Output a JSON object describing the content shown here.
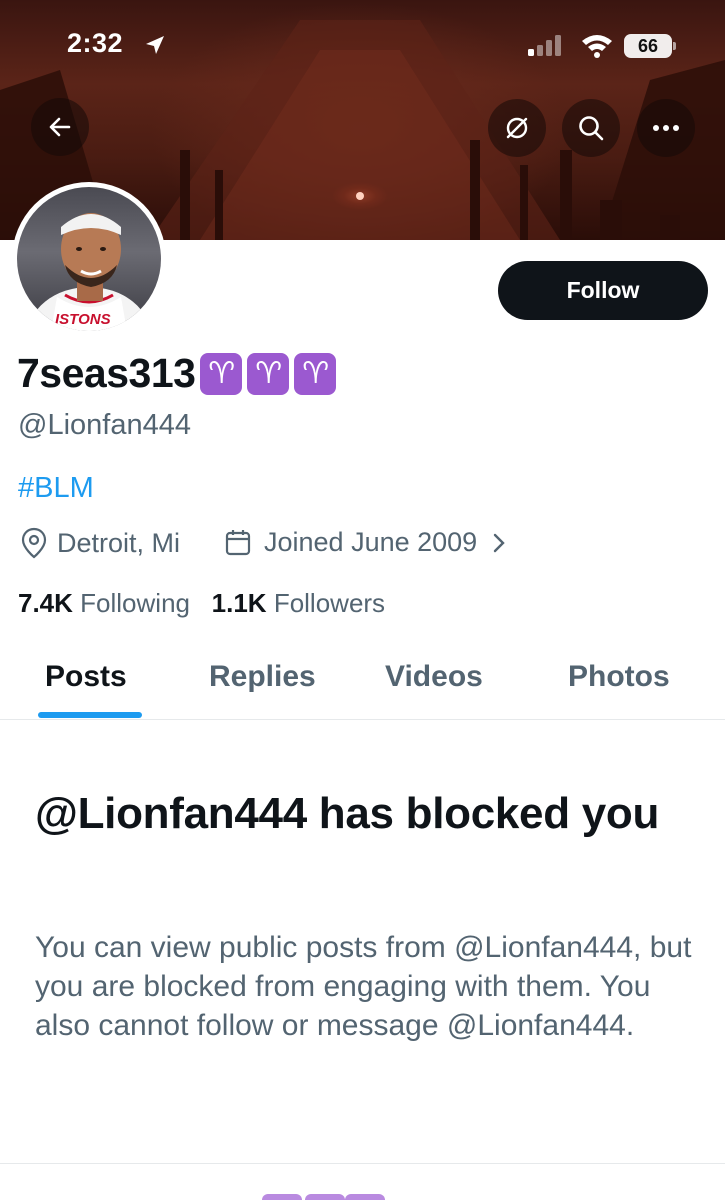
{
  "status_bar": {
    "time": "2:32",
    "battery": "66"
  },
  "header": {
    "follow_label": "Follow"
  },
  "profile": {
    "display_name": "7seas313",
    "name_emoji": "♈",
    "handle": "@Lionfan444",
    "bio": "#BLM",
    "location": "Detroit, Mi",
    "joined": "Joined June 2009",
    "following_count": "7.4K",
    "following_label": "Following",
    "followers_count": "1.1K",
    "followers_label": "Followers",
    "avatar_jersey_text": "ISTONS"
  },
  "tabs": [
    {
      "label": "Posts",
      "active": true
    },
    {
      "label": "Replies",
      "active": false
    },
    {
      "label": "Videos",
      "active": false
    },
    {
      "label": "Photos",
      "active": false
    }
  ],
  "blocked": {
    "title": "@Lionfan444 has blocked you",
    "message": "You can view public posts from @Lionfan444, but you are blocked from engaging with them. You also cannot follow or message @Lionfan444."
  },
  "colors": {
    "accent": "#1d9bf0",
    "text_primary": "#0f1419",
    "text_secondary": "#536471",
    "follow_button": "#0f1419",
    "emoji_bg": "#9b59d0"
  },
  "icons": [
    "arrow-left-icon",
    "grok-icon",
    "search-icon",
    "more-icon",
    "location-pin-icon",
    "calendar-icon",
    "chevron-right-icon",
    "signal-icon",
    "wifi-icon",
    "battery-icon",
    "location-arrow-icon"
  ]
}
